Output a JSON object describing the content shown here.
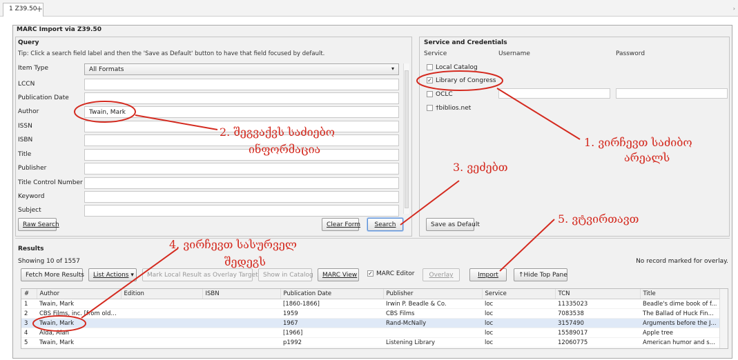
{
  "tab": {
    "label": "1 Z39.50",
    "add": "+"
  },
  "window": {
    "title": "MARC Import via Z39.50"
  },
  "query": {
    "title": "Query",
    "tip": "Tip: Click a search field label and then the 'Save as Default' button to have that field focused by default.",
    "fields": [
      {
        "label": "Item Type",
        "value": "All Formats"
      },
      {
        "label": "LCCN",
        "value": ""
      },
      {
        "label": "Publication Date",
        "value": ""
      },
      {
        "label": "Author",
        "value": "Twain, Mark"
      },
      {
        "label": "ISSN",
        "value": ""
      },
      {
        "label": "ISBN",
        "value": ""
      },
      {
        "label": "Title",
        "value": ""
      },
      {
        "label": "Publisher",
        "value": ""
      },
      {
        "label": "Title Control Number",
        "value": ""
      },
      {
        "label": "Keyword",
        "value": ""
      },
      {
        "label": "Subject",
        "value": ""
      }
    ],
    "raw_search": "Raw Search",
    "clear_form": "Clear Form",
    "search": "Search"
  },
  "service": {
    "title": "Service and Credentials",
    "col_service": "Service",
    "col_username": "Username",
    "col_password": "Password",
    "items": [
      {
        "label": "Local Catalog",
        "checked": false
      },
      {
        "label": "Library of Congress",
        "checked": true
      },
      {
        "label": "OCLC",
        "checked": false
      },
      {
        "label": "†biblios.net",
        "checked": false
      }
    ],
    "save_default": "Save as Default"
  },
  "results": {
    "title": "Results",
    "showing": "Showing 10 of 1557",
    "no_record": "No record marked for overlay.",
    "buttons": {
      "fetch_more": "Fetch More Results",
      "list_actions": "List Actions",
      "mark_local": "Mark Local Result as Overlay Target",
      "show_catalog": "Show in Catalog",
      "marc_view": "MARC View",
      "marc_editor": "MARC Editor",
      "overlay": "Overlay",
      "import": "Import",
      "hide_top": "Hide Top Pane"
    },
    "columns": [
      "#",
      "Author",
      "Edition",
      "ISBN",
      "Publication Date",
      "Publisher",
      "Service",
      "TCN",
      "Title"
    ],
    "rows": [
      [
        "1",
        "Twain, Mark",
        "",
        "",
        "[1860-1866]",
        "Irwin P. Beadle & Co.",
        "loc",
        "11335023",
        "Beadle's dime book of f..."
      ],
      [
        "2",
        "CBS Films, inc. [from old c...",
        "",
        "",
        "1959",
        "CBS Films",
        "loc",
        "7083538",
        "The Ballad of Huck Fin..."
      ],
      [
        "3",
        "Twain, Mark",
        "",
        "",
        "1967",
        "Rand-McNally",
        "loc",
        "3157490",
        "Arguments before the J..."
      ],
      [
        "4",
        "Alda, Alan",
        "",
        "",
        "[1966]",
        "",
        "loc",
        "15589017",
        "Apple tree"
      ],
      [
        "5",
        "Twain, Mark",
        "",
        "",
        "p1992",
        "Listening Library",
        "loc",
        "12060775",
        "American humor and s..."
      ]
    ]
  },
  "annotations": {
    "a1_line1": "1. ვირჩევთ საძიბო",
    "a1_line2": "არეალს",
    "a2_line1": "2. შეგვაქვს საძიებო",
    "a2_line2": "ინფორმაცია",
    "a3": "3. ვეძებთ",
    "a4_line1": "4. ვირჩევთ სასურველ",
    "a4_line2": "შედეგს",
    "a5": "5. ვტვირთავთ",
    "color": "#d42a1f"
  }
}
